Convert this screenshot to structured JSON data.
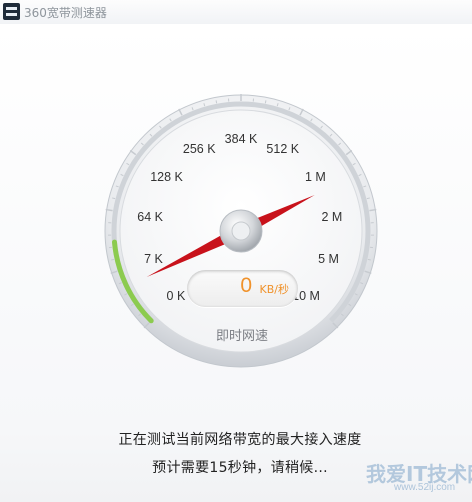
{
  "window": {
    "title": "360宽带测速器"
  },
  "gauge": {
    "labels": [
      "0 K",
      "7 K",
      "64 K",
      "128 K",
      "256 K",
      "384 K",
      "512 K",
      "1 M",
      "2 M",
      "5 M",
      "10 M"
    ],
    "readout_value": "0",
    "readout_unit": "KB/秒",
    "mode_label": "即时网速"
  },
  "status": {
    "line1": "正在测试当前网络带宽的最大接入速度",
    "line2": "预计需要15秒钟，请稍候..."
  },
  "watermark": {
    "logo": "我爱IT技术网",
    "url": "www.52ij.com"
  },
  "colors": {
    "needle": "#c8121b",
    "accent_progress": "#8ccb4f",
    "readout_text": "#f0922b"
  }
}
